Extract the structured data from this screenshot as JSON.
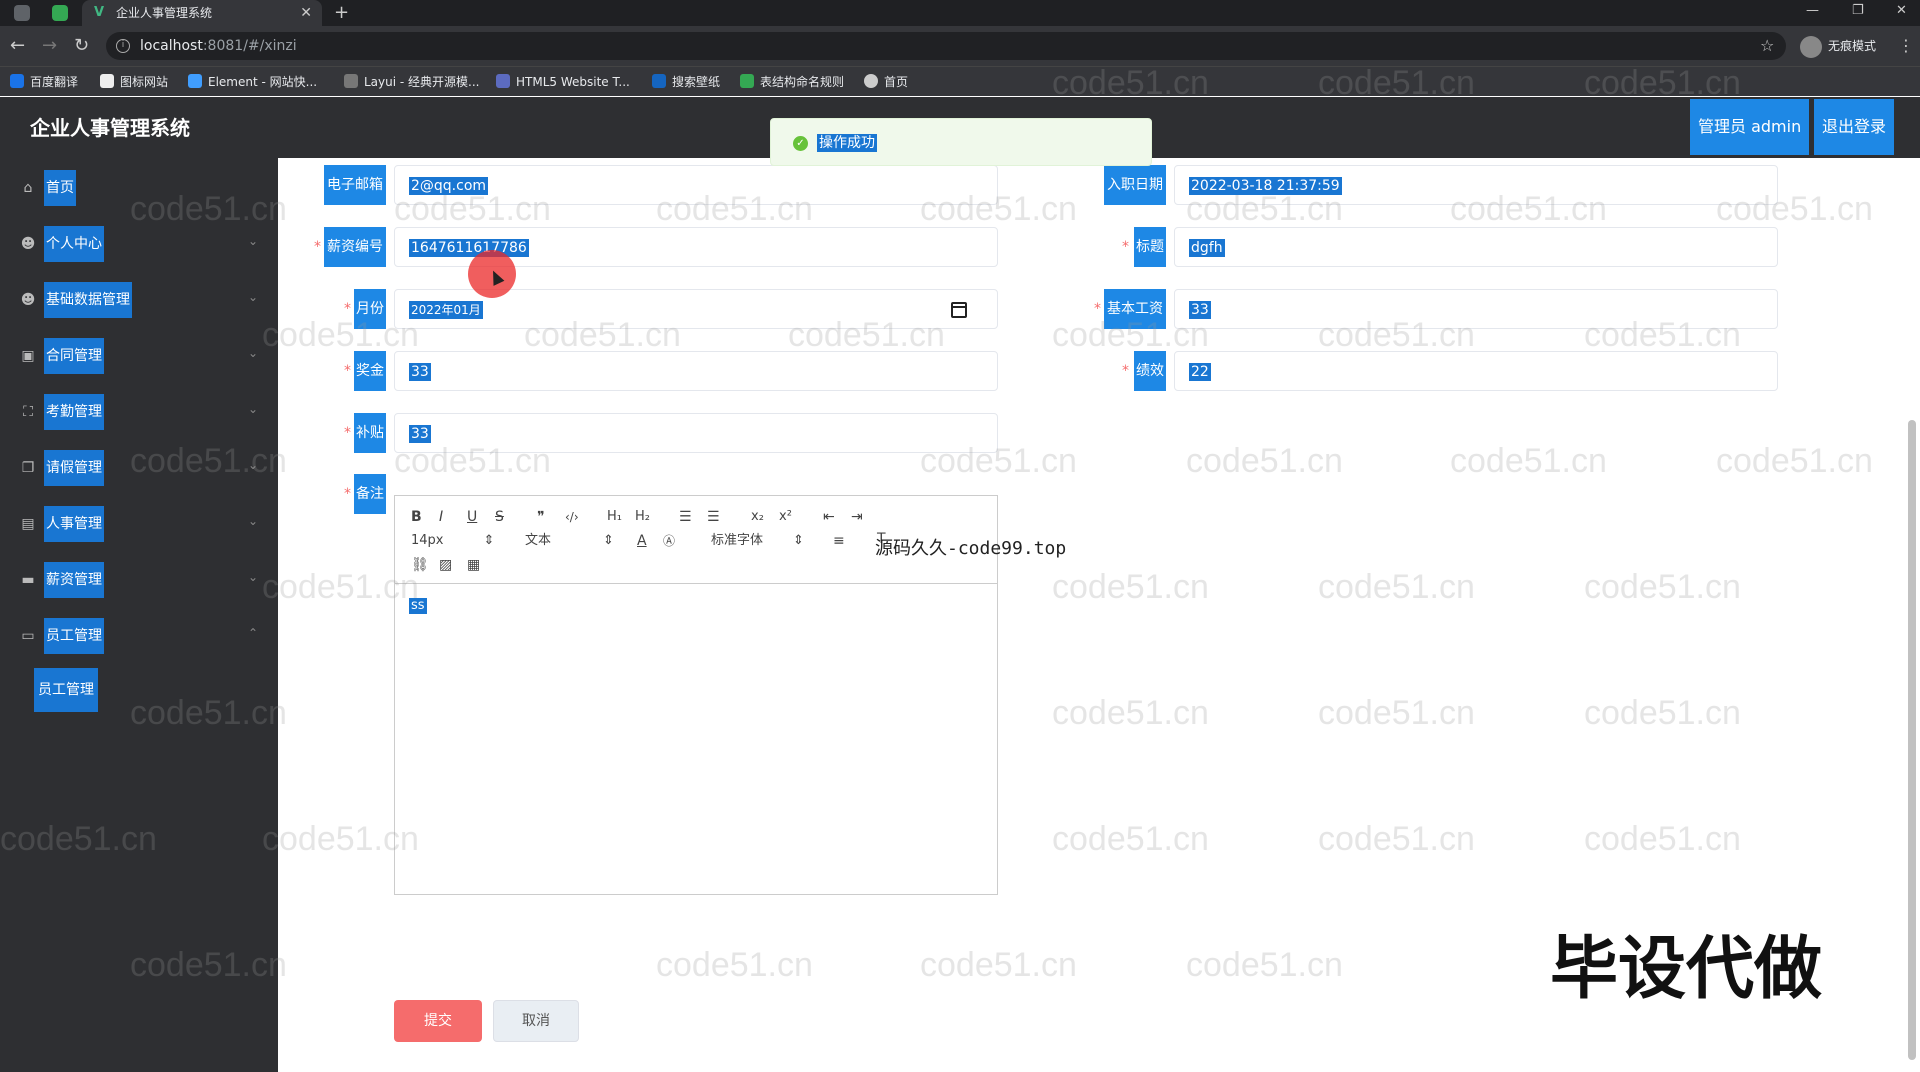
{
  "browser": {
    "tab_title": "企业人事管理系统",
    "tab_favicon": "V",
    "url_host": "localhost",
    "url_rest": ":8081/#/xinzi",
    "profile_label": "无痕模式",
    "bookmarks": [
      "百度翻译",
      "图标网站",
      "Element - 网站快...",
      "Layui - 经典开源模...",
      "HTML5 Website T...",
      "搜索壁纸",
      "表结构命名规则",
      "首页"
    ]
  },
  "header": {
    "title": "企业人事管理系统",
    "admin_label": "管理员 admin",
    "logout_label": "退出登录"
  },
  "sidebar": {
    "items": [
      {
        "label": "首页",
        "icon": "home-icon",
        "glyph": "⌂"
      },
      {
        "label": "个人中心",
        "icon": "user-icon",
        "glyph": "☻"
      },
      {
        "label": "基础数据管理",
        "icon": "user-icon",
        "glyph": "☻"
      },
      {
        "label": "合同管理",
        "icon": "contract-icon",
        "glyph": "▣"
      },
      {
        "label": "考勤管理",
        "icon": "fullscreen-icon",
        "glyph": "⛶"
      },
      {
        "label": "请假管理",
        "icon": "copy-icon",
        "glyph": "❐"
      },
      {
        "label": "人事管理",
        "icon": "document-icon",
        "glyph": "▤"
      },
      {
        "label": "薪资管理",
        "icon": "monitor-icon",
        "glyph": "▬"
      },
      {
        "label": "员工管理",
        "icon": "chat-icon",
        "glyph": "▭"
      }
    ],
    "sub_item": "员工管理"
  },
  "toast": {
    "message": "操作成功"
  },
  "form": {
    "email": {
      "label": "电子邮箱",
      "value": "2@qq.com"
    },
    "hire_date": {
      "label": "入职日期",
      "value": "2022-03-18 21:37:59"
    },
    "salary_no": {
      "label": "薪资编号",
      "value": "1647611617786"
    },
    "title": {
      "label": "标题",
      "value": "dgfh"
    },
    "month": {
      "label": "月份",
      "value": "2022年01月"
    },
    "base_salary": {
      "label": "基本工资",
      "value": "33"
    },
    "bonus": {
      "label": "奖金",
      "value": "33"
    },
    "performance": {
      "label": "绩效",
      "value": "22"
    },
    "allowance": {
      "label": "补贴",
      "value": "33"
    },
    "remark": {
      "label": "备注",
      "value": "ss"
    },
    "editor": {
      "font_size": "14px",
      "block_type": "文本",
      "font_family": "标准字体"
    },
    "submit_label": "提交",
    "cancel_label": "取消"
  },
  "overlay_text": "源码久久-code99.top",
  "banner_text": "毕设代做",
  "watermark": "code51.cn"
}
